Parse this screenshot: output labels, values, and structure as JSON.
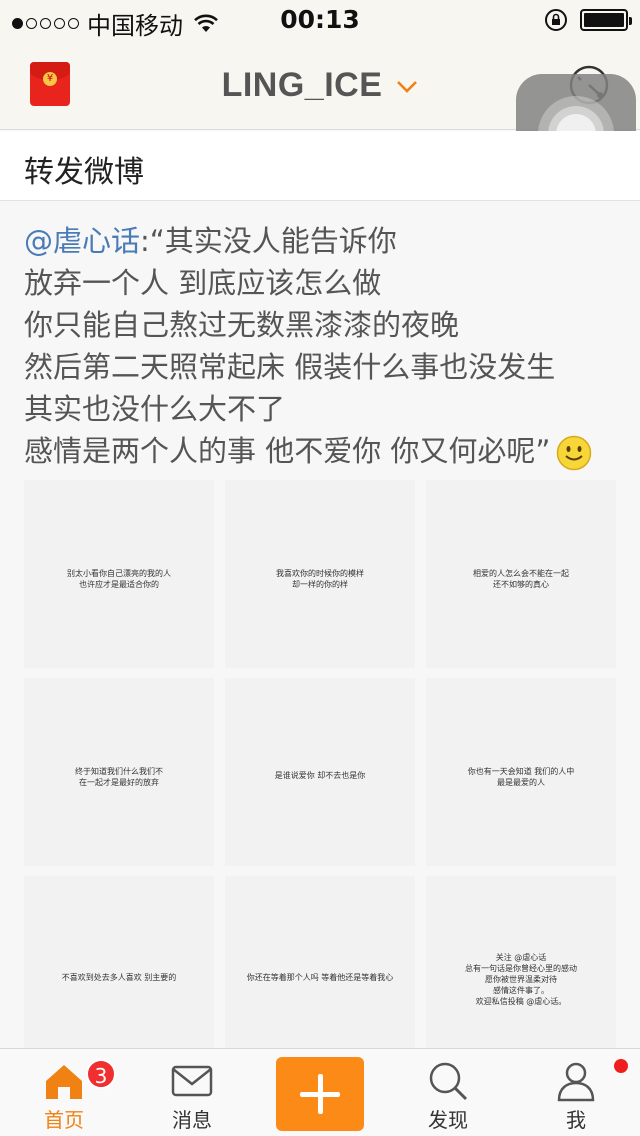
{
  "status_bar": {
    "carrier": "中国移动",
    "time": "00:13"
  },
  "nav": {
    "title": "LING_ICE"
  },
  "section": {
    "title": "转发微博"
  },
  "post": {
    "mention": "@虐心话",
    "lines": [
      ":“其实没人能告诉你",
      "放弃一个人 到底应该怎么做",
      "你只能自己熬过无数黑漆漆的夜晚",
      "然后第二天照常起床 假装什么事也没发生",
      "其实也没什么大不了",
      "感情是两个人的事 他不爱你 你又何必呢”"
    ]
  },
  "images": [
    {
      "caption": "别太小看你自己漂亮的我的人\n也许应才是最适合你的"
    },
    {
      "caption": "我喜欢你的时候你的模样\n却一样的你的样"
    },
    {
      "caption": "相爱的人怎么会不能在一起\n还不如够的真心"
    },
    {
      "caption": "终于知道我们什么我们不\n在一起才是最好的放弃"
    },
    {
      "caption": "是谁说爱你 却不去也是你"
    },
    {
      "caption": "你也有一天会知道 我们的人中\n最是最爱的人"
    },
    {
      "caption": "不喜欢到处去多人喜欢 别主要的"
    },
    {
      "caption": "你还在等着那个人吗 等着他还是等着我心"
    },
    {
      "caption": "关注 @虐心话\n总有一句话是你曾经心里的感动\n愿你被世界温柔对待\n感情这件事了。\n欢迎私信投稿 @虐心话。"
    }
  ],
  "tabs": [
    {
      "label": "首页",
      "badge": "3",
      "icon": "home-icon"
    },
    {
      "label": "消息",
      "icon": "mail-icon"
    },
    {
      "label": "",
      "icon": "plus-icon"
    },
    {
      "label": "发现",
      "icon": "search-icon"
    },
    {
      "label": "我",
      "icon": "person-icon"
    }
  ],
  "colors": {
    "accent": "#fb8a17",
    "mention": "#4a7bb7",
    "badge": "#f03030"
  }
}
